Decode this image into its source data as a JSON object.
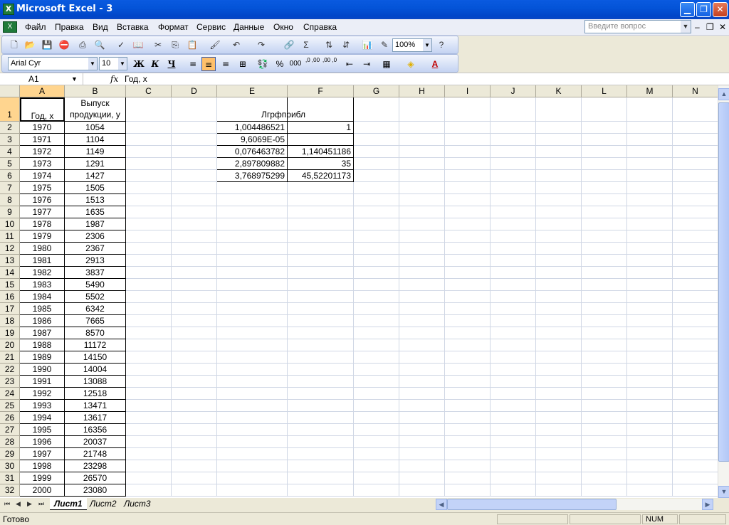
{
  "window": {
    "title": "Microsoft Excel - 3"
  },
  "menu": {
    "items": [
      "Файл",
      "Правка",
      "Вид",
      "Вставка",
      "Формат",
      "Сервис",
      "Данные",
      "Окно",
      "Справка"
    ],
    "question_placeholder": "Введите вопрос"
  },
  "toolbar": {
    "zoom": "100%",
    "font_name": "Arial Cyr",
    "font_size": "10",
    "bold_label": "Ж",
    "italic_label": "К",
    "underline_label": "Ч",
    "sigma_label": "Σ",
    "percent_label": "%",
    "thousands_label": "000",
    "inc_decimal_label": ",0 ,00",
    "dec_decimal_label": ",00 ,0",
    "font_color_label": "A"
  },
  "formula_bar": {
    "name_box": "A1",
    "fx_label": "fx",
    "formula": "Год, x"
  },
  "columns": [
    "A",
    "B",
    "C",
    "D",
    "E",
    "F",
    "G",
    "H",
    "I",
    "J",
    "K",
    "L",
    "M",
    "N"
  ],
  "rows": [
    "1",
    "2",
    "3",
    "4",
    "5",
    "6",
    "7",
    "8",
    "9",
    "10",
    "11",
    "12",
    "13",
    "14",
    "15",
    "16",
    "17",
    "18",
    "19",
    "20",
    "21",
    "22",
    "23",
    "24",
    "25",
    "26",
    "27",
    "28",
    "29",
    "30",
    "31",
    "32"
  ],
  "headers": {
    "a1": "Год, x",
    "b1_line1": "Выпуск",
    "b1_line2": "продукции, y",
    "e1": "Лгрфприбл"
  },
  "data_rows": [
    [
      "1970",
      "1054"
    ],
    [
      "1971",
      "1104"
    ],
    [
      "1972",
      "1149"
    ],
    [
      "1973",
      "1291"
    ],
    [
      "1974",
      "1427"
    ],
    [
      "1975",
      "1505"
    ],
    [
      "1976",
      "1513"
    ],
    [
      "1977",
      "1635"
    ],
    [
      "1978",
      "1987"
    ],
    [
      "1979",
      "2306"
    ],
    [
      "1980",
      "2367"
    ],
    [
      "1981",
      "2913"
    ],
    [
      "1982",
      "3837"
    ],
    [
      "1983",
      "5490"
    ],
    [
      "1984",
      "5502"
    ],
    [
      "1985",
      "6342"
    ],
    [
      "1986",
      "7665"
    ],
    [
      "1987",
      "8570"
    ],
    [
      "1988",
      "11172"
    ],
    [
      "1989",
      "14150"
    ],
    [
      "1990",
      "14004"
    ],
    [
      "1991",
      "13088"
    ],
    [
      "1992",
      "12518"
    ],
    [
      "1993",
      "13471"
    ],
    [
      "1994",
      "13617"
    ],
    [
      "1995",
      "16356"
    ],
    [
      "1996",
      "20037"
    ],
    [
      "1997",
      "21748"
    ],
    [
      "1998",
      "23298"
    ],
    [
      "1999",
      "26570"
    ],
    [
      "2000",
      "23080"
    ]
  ],
  "logest": [
    [
      "1,004486521",
      "1"
    ],
    [
      "9,6069E-05",
      ""
    ],
    [
      "0,076463782",
      "1,140451186"
    ],
    [
      "2,897809882",
      "35"
    ],
    [
      "3,768975299",
      "45,52201173"
    ]
  ],
  "sheets": [
    "Лист1",
    "Лист2",
    "Лист3"
  ],
  "status": {
    "ready": "Готово",
    "num": "NUM"
  },
  "colors": {
    "title_bar": "#0454d8",
    "selected_header": "#ffd58f",
    "grid_line": "#d0d7e5"
  }
}
